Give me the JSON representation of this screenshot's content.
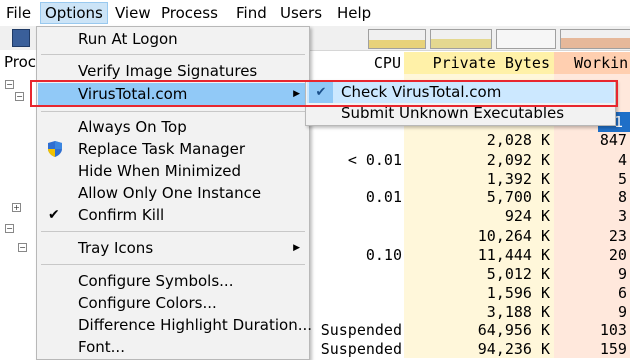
{
  "menubar": {
    "items": [
      {
        "label": "File"
      },
      {
        "label": "Options"
      },
      {
        "label": "View"
      },
      {
        "label": "Process"
      },
      {
        "label": "Find"
      },
      {
        "label": "Users"
      },
      {
        "label": "Help"
      }
    ]
  },
  "tree": {
    "header": "Proc"
  },
  "columns": {
    "cpu": "CPU",
    "private_bytes": "Private Bytes",
    "working_set": "Workin"
  },
  "options_menu": {
    "run_at_logon": "Run At Logon",
    "verify_image_signatures": "Verify Image Signatures",
    "virustotal": "VirusTotal.com",
    "always_on_top": "Always On Top",
    "replace_task_manager": "Replace Task Manager",
    "hide_when_minimized": "Hide When Minimized",
    "allow_one_instance": "Allow Only One Instance",
    "confirm_kill": "Confirm Kill",
    "tray_icons": "Tray Icons",
    "configure_symbols": "Configure Symbols...",
    "configure_colors": "Configure Colors...",
    "difference_highlight": "Difference Highlight Duration...",
    "font": "Font..."
  },
  "virustotal_submenu": {
    "check": "Check VirusTotal.com",
    "submit": "Submit Unknown Executables"
  },
  "rows": [
    {
      "cpu": "",
      "pb": "2,028 K",
      "ws": "847,"
    },
    {
      "cpu": "< 0.01",
      "pb": "2,092 K",
      "ws": "4,"
    },
    {
      "cpu": "",
      "pb": "1,392 K",
      "ws": "5,"
    },
    {
      "cpu": "0.01",
      "pb": "5,700 K",
      "ws": "8,"
    },
    {
      "cpu": "",
      "pb": "924 K",
      "ws": "3,"
    },
    {
      "cpu": "",
      "pb": "10,264 K",
      "ws": "23,"
    },
    {
      "cpu": "0.10",
      "pb": "11,444 K",
      "ws": "20,"
    },
    {
      "cpu": "",
      "pb": "5,012 K",
      "ws": "9,"
    },
    {
      "cpu": "",
      "pb": "1,596 K",
      "ws": "6,"
    },
    {
      "cpu": "",
      "pb": "3,188 K",
      "ws": "9,"
    },
    {
      "cpu": "Suspended",
      "pb": "64,956 K",
      "ws": "103,"
    },
    {
      "cpu": "Suspended",
      "pb": "94,236 K",
      "ws": "159,"
    }
  ],
  "colors": {
    "menu_highlight": "#91c9f7",
    "red_highlight": "#e8262e",
    "private_bytes_bg": "#fff7da",
    "working_set_bg": "#ffe8dc"
  }
}
